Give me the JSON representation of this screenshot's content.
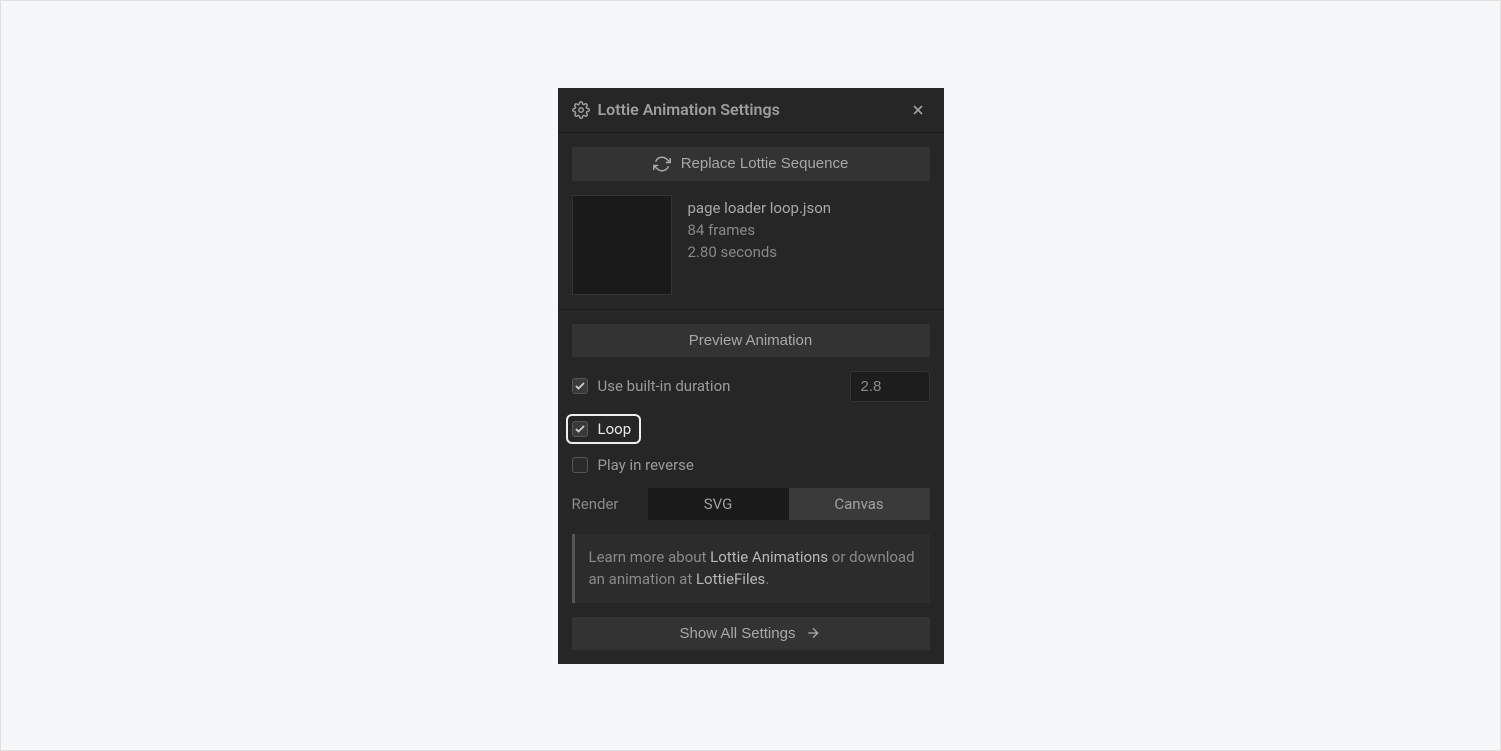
{
  "header": {
    "title": "Lottie Animation Settings"
  },
  "buttons": {
    "replace": "Replace Lottie Sequence",
    "preview": "Preview Animation",
    "show_all": "Show All Settings"
  },
  "file": {
    "name": "page loader loop.json",
    "frames": "84 frames",
    "seconds": "2.80 seconds"
  },
  "checks": {
    "builtin_duration": "Use built-in duration",
    "loop": "Loop",
    "reverse": "Play in reverse"
  },
  "duration_value": "2.8",
  "render": {
    "label": "Render",
    "svg": "SVG",
    "canvas": "Canvas"
  },
  "info": {
    "prefix": "Learn more about ",
    "link1": "Lottie Animations",
    "mid": " or download an animation at ",
    "link2": "LottieFiles",
    "suffix": "."
  }
}
